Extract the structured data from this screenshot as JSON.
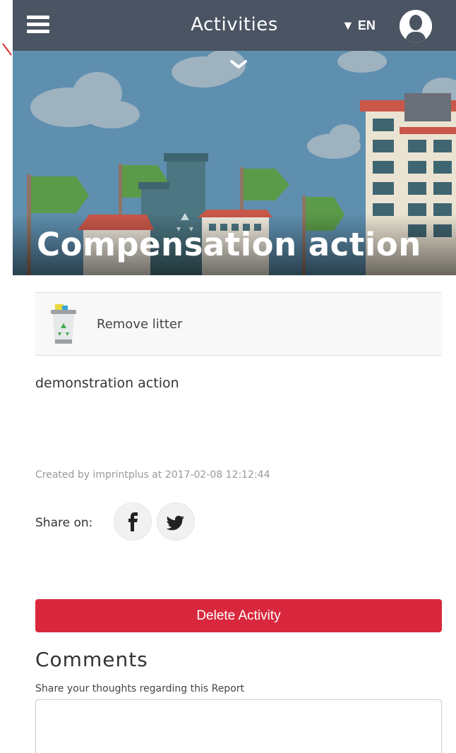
{
  "header": {
    "title": "Activities",
    "language_selector": "▼ EN",
    "menu_icon": "hamburger-menu-icon",
    "avatar_icon": "user-avatar-icon"
  },
  "hero": {
    "title": "Compensation action",
    "expand_icon": "chevron-down-icon"
  },
  "category": {
    "icon": "recycle-bin-icon",
    "label": "Remove litter"
  },
  "activity": {
    "description": "demonstration action",
    "created": "Created by imprintplus at 2017-02-08 12:12:44"
  },
  "share": {
    "label": "Share on:",
    "facebook_icon": "facebook-icon",
    "twitter_icon": "twitter-icon"
  },
  "actions": {
    "delete_label": "Delete Activity"
  },
  "comments": {
    "title": "Comments",
    "hint": "Share your thoughts regarding this Report",
    "input_value": ""
  },
  "colors": {
    "topbar": "#4a5462",
    "sky": "#5f8faf",
    "delete": "#d9283d"
  }
}
